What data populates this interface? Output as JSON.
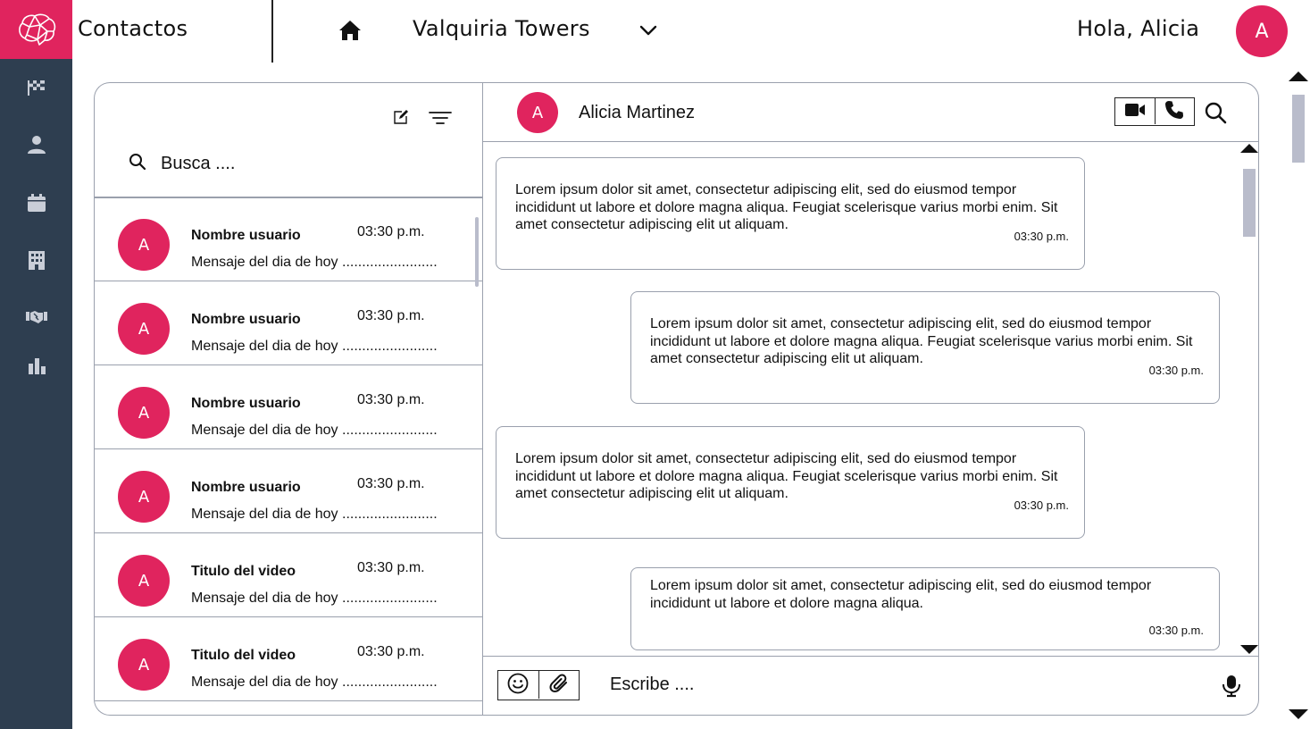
{
  "app": {
    "title": "Contactos",
    "accent_color": "#e0245e",
    "sidebar_color": "#2e3e50"
  },
  "sidebar": {
    "items": [
      {
        "icon": "flag-icon"
      },
      {
        "icon": "user-icon"
      },
      {
        "icon": "calendar-icon"
      },
      {
        "icon": "building-icon"
      },
      {
        "icon": "handshake-icon"
      },
      {
        "icon": "bar-chart-icon"
      }
    ]
  },
  "header": {
    "building": "Valquiria Towers",
    "greeting": "Hola, Alicia",
    "user_initial": "A"
  },
  "contacts": {
    "search_placeholder": "Busca ....",
    "items": [
      {
        "initial": "A",
        "name": "Nombre usuario",
        "time": "03:30 p.m.",
        "message": "Mensaje del dia de hoy ........................"
      },
      {
        "initial": "A",
        "name": "Nombre usuario",
        "time": "03:30 p.m.",
        "message": "Mensaje del dia de hoy ........................"
      },
      {
        "initial": "A",
        "name": "Nombre usuario",
        "time": "03:30 p.m.",
        "message": "Mensaje del dia de hoy ........................"
      },
      {
        "initial": "A",
        "name": "Nombre usuario",
        "time": "03:30 p.m.",
        "message": "Mensaje del dia de hoy ........................"
      },
      {
        "initial": "A",
        "name": "Titulo del video",
        "time": "03:30 p.m.",
        "message": "Mensaje del dia de hoy ........................"
      },
      {
        "initial": "A",
        "name": "Titulo del video",
        "time": "03:30 p.m.",
        "message": "Mensaje del dia de hoy ........................"
      }
    ]
  },
  "chat": {
    "contact_initial": "A",
    "contact_name": "Alicia Martinez",
    "messages": [
      {
        "direction": "in",
        "text": "Lorem ipsum dolor sit amet, consectetur adipiscing elit, sed do eiusmod tempor incididunt ut labore et dolore magna aliqua. Feugiat scelerisque varius morbi enim. Sit amet consectetur adipiscing elit ut aliquam.",
        "time": "03:30 p.m."
      },
      {
        "direction": "out",
        "text": "Lorem ipsum dolor sit amet, consectetur adipiscing elit, sed do eiusmod tempor incididunt ut labore et dolore magna aliqua. Feugiat scelerisque varius morbi enim. Sit amet consectetur adipiscing elit ut aliquam.",
        "time": "03:30 p.m."
      },
      {
        "direction": "in",
        "text": "Lorem ipsum dolor sit amet, consectetur adipiscing elit, sed do eiusmod tempor incididunt ut labore et dolore magna aliqua. Feugiat scelerisque varius morbi enim. Sit amet consectetur adipiscing elit ut aliquam.",
        "time": "03:30 p.m."
      },
      {
        "direction": "out",
        "text": "Lorem ipsum dolor sit amet, consectetur adipiscing elit, sed do eiusmod tempor incididunt ut labore et dolore magna aliqua.",
        "time": "03:30 p.m."
      }
    ],
    "composer_placeholder": "Escribe ...."
  }
}
